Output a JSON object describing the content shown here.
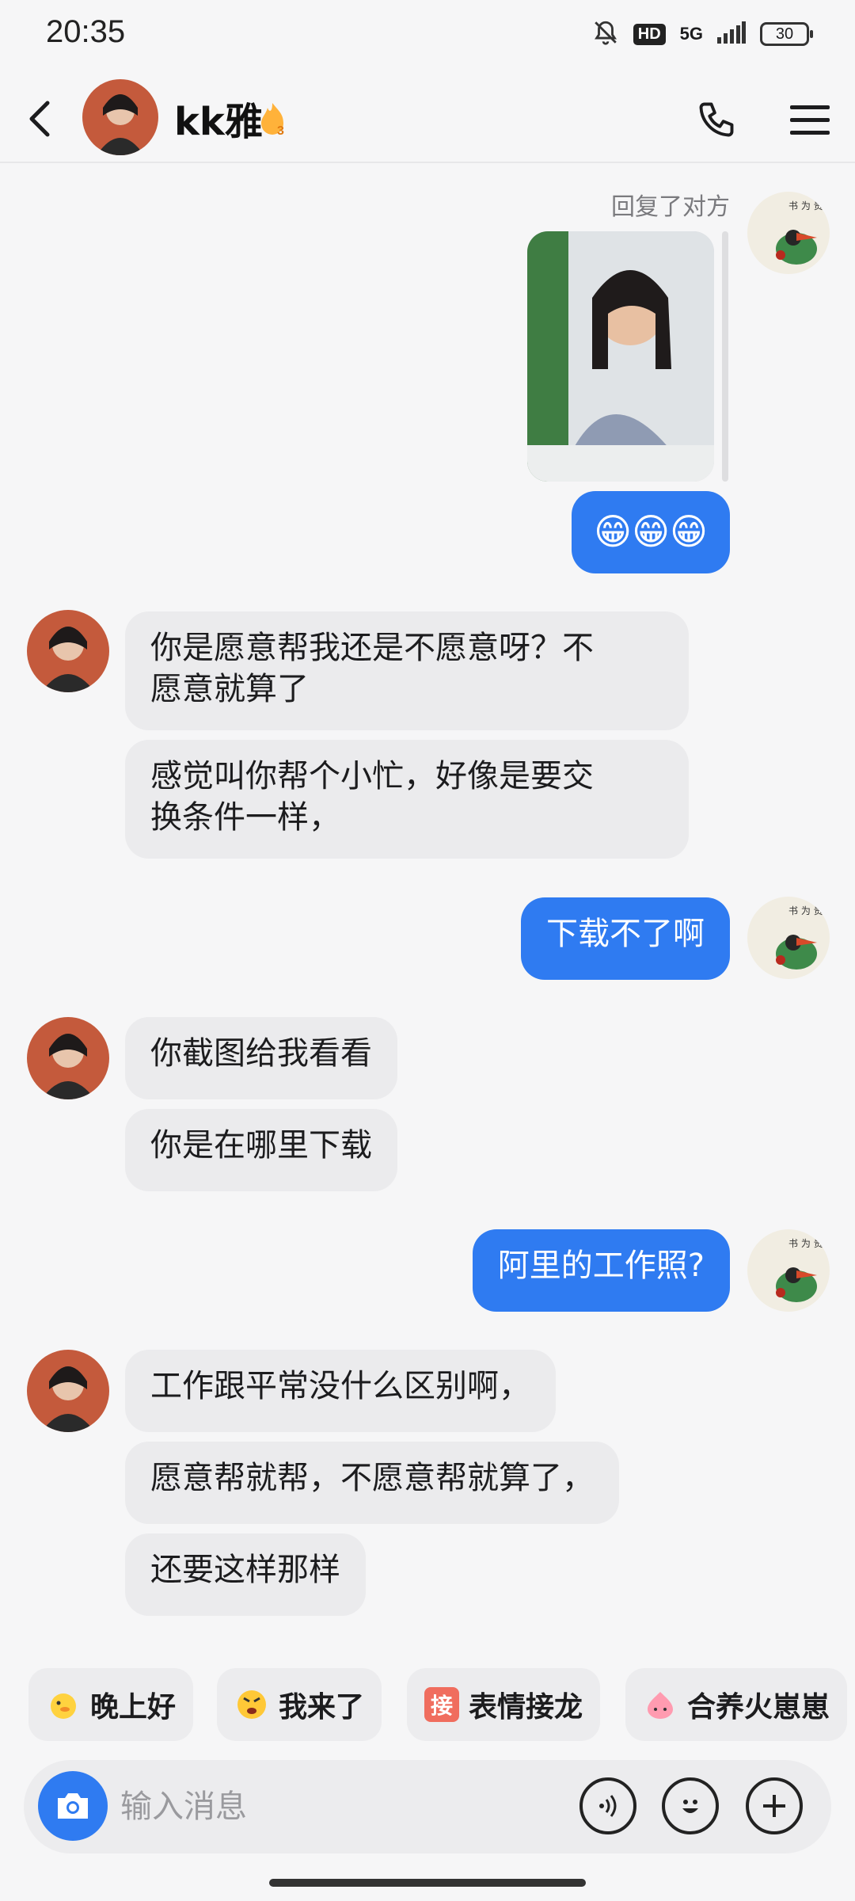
{
  "status_bar": {
    "time": "20:35",
    "hd": "HD",
    "network": "5G",
    "battery": "30",
    "icons": [
      "bell-off-icon",
      "signal-icon",
      "battery-icon"
    ]
  },
  "header": {
    "title": "kk雅",
    "streak": "3",
    "icons": [
      "back-arrow-icon",
      "avatar",
      "flame-icon",
      "phone-icon",
      "menu-icon"
    ]
  },
  "chat": {
    "reply_label": "回复了对方",
    "messages": [
      {
        "from": "me",
        "emoji": "😁😁😁"
      },
      {
        "from": "her",
        "text": "你是愿意帮我还是不愿意呀？不\n愿意就算了"
      },
      {
        "from": "her",
        "text": "感觉叫你帮个小忙，好像是要交\n换条件一样，"
      },
      {
        "from": "me",
        "text": "下载不了啊"
      },
      {
        "from": "her",
        "text": "你截图给我看看"
      },
      {
        "from": "her",
        "text": "你是在哪里下载"
      },
      {
        "from": "me",
        "text": "阿里的工作照?"
      },
      {
        "from": "her",
        "text": "工作跟平常没什么区别啊，"
      },
      {
        "from": "her",
        "text": "愿意帮就帮，不愿意帮就算了，"
      },
      {
        "from": "her",
        "text": "还要这样那样"
      }
    ]
  },
  "quick_replies": [
    {
      "label": "晚上好",
      "icon": "duck-icon"
    },
    {
      "label": "我来了",
      "icon": "angry-face-icon"
    },
    {
      "label": "表情接龙",
      "icon_text": "接"
    },
    {
      "label": "合养火崽崽",
      "icon": "fire-sprite-icon"
    }
  ],
  "input": {
    "placeholder": "输入消息"
  },
  "colors": {
    "accent": "#2f7bf1",
    "incoming_bubble": "#ebebed",
    "background": "#f6f6f7"
  }
}
